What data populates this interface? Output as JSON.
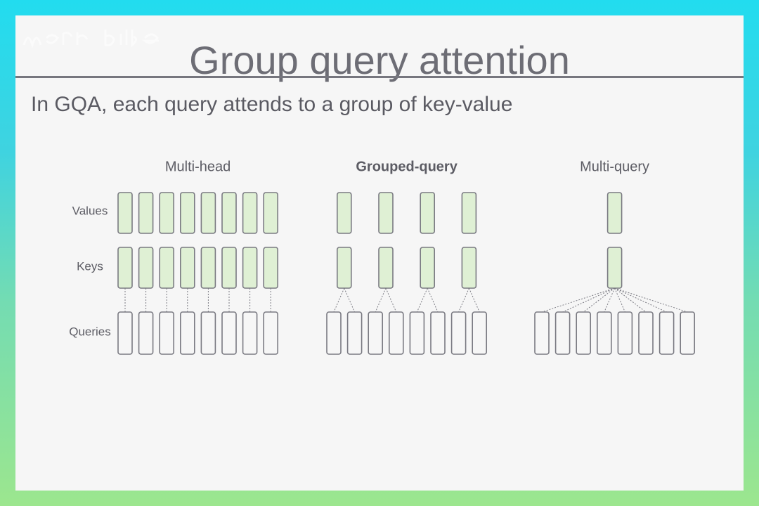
{
  "slide": {
    "title": "Group query attention",
    "subtitle": "In GQA, each query attends to a group of key-value"
  },
  "diagram": {
    "row_labels": {
      "values": "Values",
      "keys": "Keys",
      "queries": "Queries"
    },
    "panels": [
      {
        "name": "Multi-head",
        "bold": false,
        "queries": 8,
        "kv_heads": 8
      },
      {
        "name": "Grouped-query",
        "bold": true,
        "queries": 8,
        "kv_heads": 4
      },
      {
        "name": "Multi-query",
        "bold": false,
        "queries": 8,
        "kv_heads": 1
      }
    ]
  },
  "colors": {
    "kv_fill": "#dff0d4",
    "query_fill": "#f6f6f6",
    "box_stroke": "#7a7a82",
    "connector": "#7a7a82",
    "label_text": "#5c5c64"
  }
}
